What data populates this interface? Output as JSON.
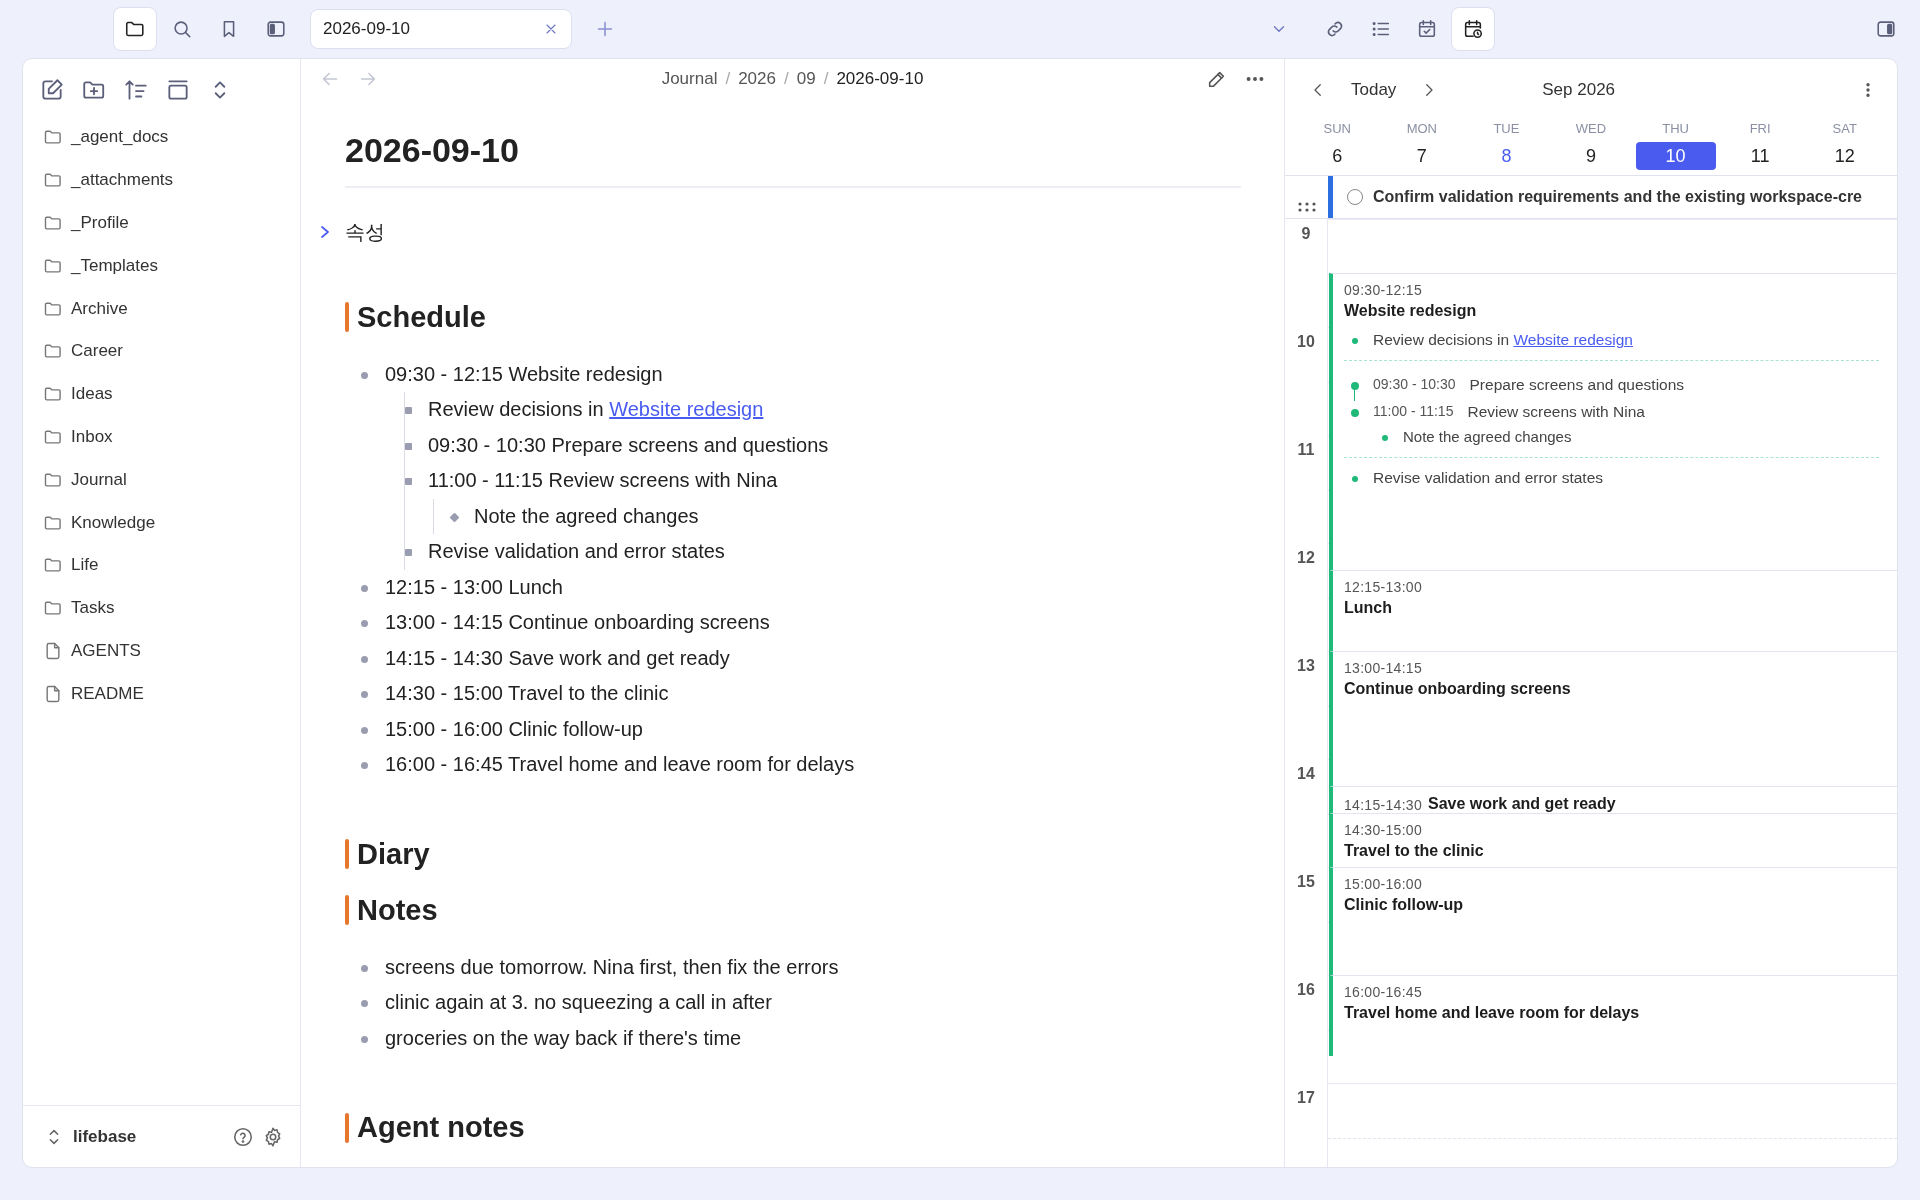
{
  "ribbon_left": [
    {
      "selected": true
    },
    {
      "selected": false
    },
    {
      "selected": false
    },
    {
      "selected": false
    }
  ],
  "tabs": [
    {
      "label": "2026-09-10",
      "selected": true
    }
  ],
  "ribbon_right": [
    {
      "selected": false
    },
    {
      "selected": false
    },
    {
      "selected": false
    },
    {
      "selected": true
    }
  ],
  "sidebar": {
    "items": [
      {
        "kind": "folder",
        "label": "_agent_docs"
      },
      {
        "kind": "folder",
        "label": "_attachments"
      },
      {
        "kind": "folder",
        "label": "_Profile"
      },
      {
        "kind": "folder",
        "label": "_Templates"
      },
      {
        "kind": "folder",
        "label": "Archive"
      },
      {
        "kind": "folder",
        "label": "Career"
      },
      {
        "kind": "folder",
        "label": "Ideas"
      },
      {
        "kind": "folder",
        "label": "Inbox"
      },
      {
        "kind": "folder",
        "label": "Journal"
      },
      {
        "kind": "folder",
        "label": "Knowledge"
      },
      {
        "kind": "folder",
        "label": "Life"
      },
      {
        "kind": "folder",
        "label": "Tasks"
      },
      {
        "kind": "file",
        "label": "AGENTS"
      },
      {
        "kind": "file",
        "label": "README"
      }
    ],
    "vault": "lifebase"
  },
  "editor": {
    "breadcrumb": [
      {
        "label": "Journal"
      },
      {
        "separator": "/",
        "label": "2026"
      },
      {
        "separator": "/",
        "label": "09"
      },
      {
        "separator": "/",
        "label": "2026-09-10"
      }
    ],
    "title": "2026-09-10",
    "properties": {
      "label": "속성",
      "expanded": false
    },
    "sections": [
      {
        "heading": "Schedule",
        "items": [
          {
            "text": "09:30 - 12:15 Website redesign",
            "children": [
              {
                "text": "Review decisions in ",
                "link": "Website redesign"
              },
              {
                "text": "09:30 - 10:30 Prepare screens and questions"
              },
              {
                "text": "11:00 - 11:15 Review screens with Nina",
                "children": [
                  {
                    "text": "Note the agreed changes"
                  }
                ]
              },
              {
                "text": "Revise validation and error states"
              }
            ]
          },
          {
            "text": "12:15 - 13:00 Lunch"
          },
          {
            "text": "13:00 - 14:15 Continue onboarding screens"
          },
          {
            "text": "14:15 - 14:30 Save work and get ready"
          },
          {
            "text": "14:30 - 15:00 Travel to the clinic"
          },
          {
            "text": "15:00 - 16:00 Clinic follow-up"
          },
          {
            "text": "16:00 - 16:45 Travel home and leave room for delays"
          }
        ]
      },
      {
        "heading": "Diary"
      },
      {
        "heading": "Notes",
        "items": [
          {
            "text": "screens due tomorrow. Nina first, then fix the errors"
          },
          {
            "text": "clinic again at 3. no squeezing a call in after"
          },
          {
            "text": "groceries on the way back if there's time"
          }
        ]
      },
      {
        "heading": "Agent notes"
      }
    ]
  },
  "calendar": {
    "today_label": "Today",
    "month": "Sep 2026",
    "days": [
      {
        "dow": "SUN",
        "date": "6",
        "selected": false,
        "today": false
      },
      {
        "dow": "MON",
        "date": "7",
        "selected": false,
        "today": false
      },
      {
        "dow": "TUE",
        "date": "8",
        "selected": false,
        "today": true
      },
      {
        "dow": "WED",
        "date": "9",
        "selected": false,
        "today": false
      },
      {
        "dow": "THU",
        "date": "10",
        "selected": true,
        "today": false
      },
      {
        "dow": "FRI",
        "date": "11",
        "selected": false,
        "today": false
      },
      {
        "dow": "SAT",
        "date": "12",
        "selected": false,
        "today": false
      }
    ],
    "all_day": [
      {
        "text": "Confirm validation requirements and the existing workspace-cre",
        "checked": false
      }
    ],
    "hours": [
      "9",
      "10",
      "11",
      "12",
      "13",
      "14",
      "15",
      "16",
      "17"
    ],
    "events": [
      {
        "time": "09:30-12:15",
        "title": "Website redesign",
        "details": [
          {
            "kind": "note",
            "text": "Review decisions in ",
            "link": "Website redesign"
          },
          {
            "kind": "subtasks",
            "items": [
              {
                "time": "09:30 - 10:30",
                "text": "Prepare screens and questions"
              },
              {
                "time": "11:00 - 11:15",
                "text": "Review screens with Nina",
                "children": [
                  {
                    "text": "Note the agreed changes"
                  }
                ]
              }
            ]
          },
          {
            "kind": "note",
            "text": "Revise validation and error states"
          }
        ]
      },
      {
        "time": "12:15-13:00",
        "title": "Lunch"
      },
      {
        "time": "13:00-14:15",
        "title": "Continue onboarding screens"
      },
      {
        "time": "14:15-14:30",
        "title": "Save work and get ready"
      },
      {
        "time": "14:30-15:00",
        "title": "Travel to the clinic"
      },
      {
        "time": "15:00-16:00",
        "title": "Clinic follow-up"
      },
      {
        "time": "16:00-16:45",
        "title": "Travel home and leave room for delays"
      }
    ]
  }
}
